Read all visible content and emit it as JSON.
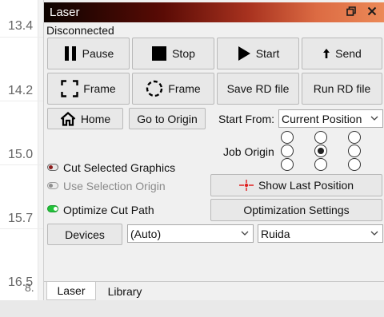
{
  "ruler": {
    "ticks": [
      "13.4",
      "14.2",
      "15.0",
      "15.7",
      "16.5",
      "8."
    ]
  },
  "window": {
    "title": "Laser",
    "status": "Disconnected"
  },
  "row1": {
    "pause": "Pause",
    "stop": "Stop",
    "start": "Start",
    "send": "Send"
  },
  "row2": {
    "frame1": "Frame",
    "frame2": "Frame",
    "save_rd": "Save RD file",
    "run_rd": "Run RD file"
  },
  "row3": {
    "home": "Home",
    "go_origin": "Go to Origin",
    "start_from_label": "Start From:",
    "start_from_value": "Current Position"
  },
  "job_origin": {
    "label": "Job Origin",
    "selected": "center"
  },
  "options": {
    "cut_selected": {
      "label": "Cut Selected Graphics",
      "on": false
    },
    "use_selection_origin": {
      "label": "Use Selection Origin",
      "on": false
    },
    "optimize_cut_path": {
      "label": "Optimize Cut Path",
      "on": true
    }
  },
  "show_last_position": "Show Last Position",
  "optimization_settings": "Optimization Settings",
  "devices": {
    "button": "Devices",
    "port": "(Auto)",
    "controller": "Ruida"
  },
  "tabs": [
    "Laser",
    "Library"
  ],
  "colors": {
    "toggle_on": "#22c23a",
    "toggle_off_knob": "#8b1c1c",
    "crosshair": "#e02020"
  }
}
